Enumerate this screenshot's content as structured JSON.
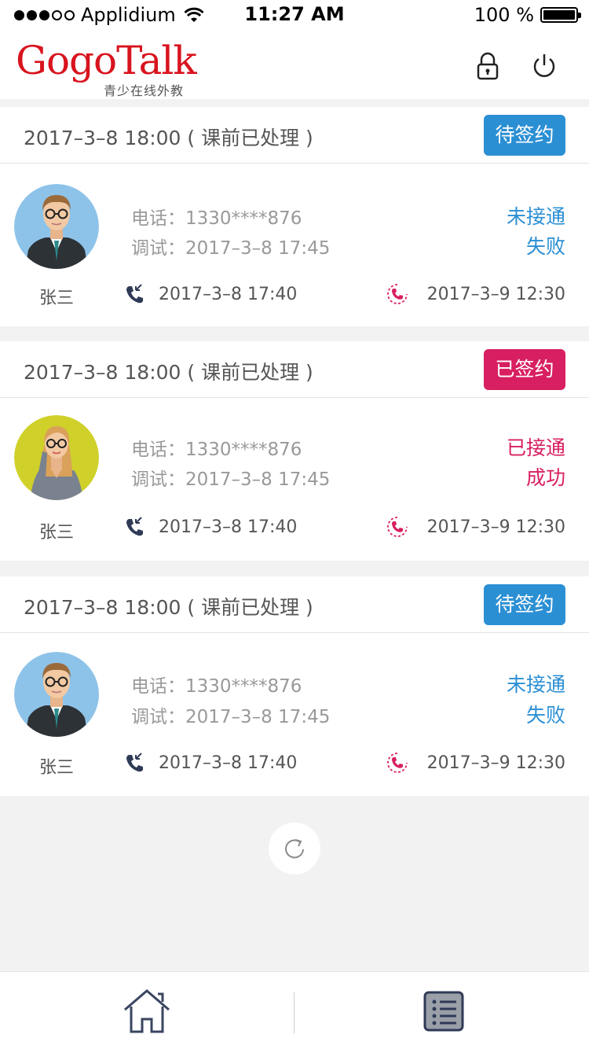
{
  "status_bar": {
    "carrier": "Applidium",
    "time": "11:27 AM",
    "battery": "100 %"
  },
  "header": {
    "logo_text": "GogoTalk",
    "logo_subtitle": "青少在线外教",
    "icons": [
      "lock-icon",
      "power-icon"
    ]
  },
  "cards": [
    {
      "date": "2017–3–8  18:00 ( 课前已处理 )",
      "badge": "待签约",
      "badge_color": "#2b8fd4",
      "name": "张三",
      "phone": "电话：1330****876",
      "debug": "调试：2017–3–8   17:45",
      "status1": "未接通",
      "status2": "失败",
      "status_color": "#2b8fd4",
      "call_time": "2017–3–8  17:40",
      "callback_time": "2017–3–9  12:30",
      "avatar": "male-avatar"
    },
    {
      "date": "2017–3–8  18:00 ( 课前已处理 )",
      "badge": "已签约",
      "badge_color": "#d81f61",
      "name": "张三",
      "phone": "电话：1330****876",
      "debug": "调试：2017–3–8   17:45",
      "status1": "已接通",
      "status2": "成功",
      "status_color": "#d81f61",
      "call_time": "2017–3–8  17:40",
      "callback_time": "2017–3–9  12:30",
      "avatar": "female-avatar"
    },
    {
      "date": "2017–3–8  18:00 ( 课前已处理 )",
      "badge": "待签约",
      "badge_color": "#2b8fd4",
      "name": "张三",
      "phone": "电话：1330****876",
      "debug": "调试：2017–3–8   17:45",
      "status1": "未接通",
      "status2": "失败",
      "status_color": "#2b8fd4",
      "call_time": "2017–3–8  17:40",
      "callback_time": "2017–3–9  12:30",
      "avatar": "male-avatar"
    }
  ],
  "tabbar": {
    "icons": [
      "home-icon",
      "list-icon"
    ]
  },
  "colors": {
    "brand": "#d8141f",
    "accent_blue": "#2b8fd4",
    "accent_pink": "#d81f61",
    "background": "#f2f2f2"
  }
}
